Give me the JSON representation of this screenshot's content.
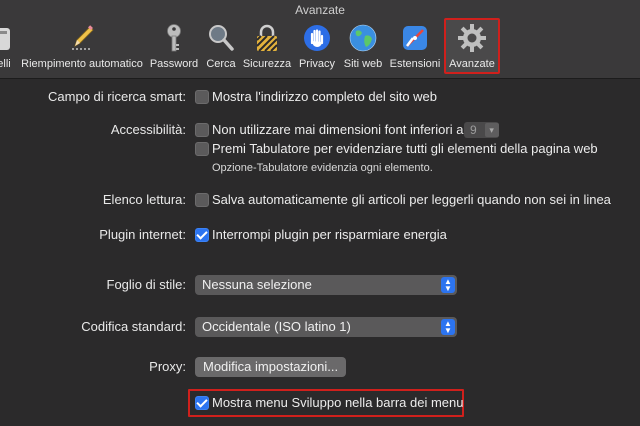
{
  "window": {
    "title": "Avanzate"
  },
  "toolbar": {
    "tabs": [
      {
        "label": "elli",
        "icon": "general-icon"
      },
      {
        "label": "Riempimento automatico",
        "icon": "pencil-icon"
      },
      {
        "label": "Password",
        "icon": "key-icon"
      },
      {
        "label": "Cerca",
        "icon": "magnifier-icon"
      },
      {
        "label": "Sicurezza",
        "icon": "lock-icon"
      },
      {
        "label": "Privacy",
        "icon": "hand-icon"
      },
      {
        "label": "Siti web",
        "icon": "globe-icon"
      },
      {
        "label": "Estensioni",
        "icon": "puzzle-icon"
      },
      {
        "label": "Avanzate",
        "icon": "gear-icon",
        "selected": true
      }
    ]
  },
  "settings": {
    "smart_search": {
      "label": "Campo di ricerca smart:",
      "option": "Mostra l'indirizzo completo del sito web",
      "checked": false
    },
    "accessibility": {
      "label": "Accessibilità:",
      "option1": "Non utilizzare mai dimensioni font inferiori a",
      "option1_checked": false,
      "font_size": "9",
      "option2": "Premi Tabulatore per evidenziare tutti gli elementi della pagina web",
      "option2_checked": false,
      "hint": "Opzione-Tabulatore evidenzia ogni elemento."
    },
    "reading_list": {
      "label": "Elenco lettura:",
      "option": "Salva automaticamente gli articoli per leggerli quando non sei in linea",
      "checked": false
    },
    "internet_plugins": {
      "label": "Plugin internet:",
      "option": "Interrompi plugin per risparmiare energia",
      "checked": true
    },
    "stylesheet": {
      "label": "Foglio di stile:",
      "value": "Nessuna selezione"
    },
    "default_encoding": {
      "label": "Codifica standard:",
      "value": "Occidentale (ISO latino 1)"
    },
    "proxy": {
      "label": "Proxy:",
      "button": "Modifica impostazioni..."
    },
    "develop_menu": {
      "option": "Mostra menu Sviluppo nella barra dei menu",
      "checked": true
    }
  },
  "colors": {
    "accent": "#2c74f0",
    "highlight_border": "#d0201c",
    "background": "#2b2a2b",
    "toolbar": "#3a393a"
  }
}
